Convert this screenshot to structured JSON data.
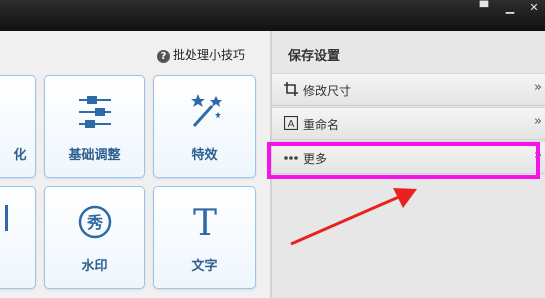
{
  "window": {
    "controls": [
      "chat-icon",
      "minimize-icon",
      "close-icon"
    ]
  },
  "left_panel": {
    "tip_label": "批处理小技巧",
    "tiles": [
      {
        "label": "化",
        "icon": "partial-icon"
      },
      {
        "label": "基础调整",
        "icon": "sliders-icon"
      },
      {
        "label": "特效",
        "icon": "magic-wand-icon"
      },
      {
        "label": "",
        "icon": "partial-icon"
      },
      {
        "label": "水印",
        "icon": "watermark-icon"
      },
      {
        "label": "文字",
        "icon": "text-T-icon"
      }
    ]
  },
  "right_panel": {
    "title": "保存设置",
    "rows": [
      {
        "label": "修改尺寸",
        "icon": "crop-icon"
      },
      {
        "label": "重命名",
        "icon": "rename-icon"
      },
      {
        "label": "更多",
        "icon": "more-dots-icon"
      }
    ]
  },
  "annotation": {
    "highlight_color": "#f414e8",
    "arrow_color": "#e8231e"
  }
}
